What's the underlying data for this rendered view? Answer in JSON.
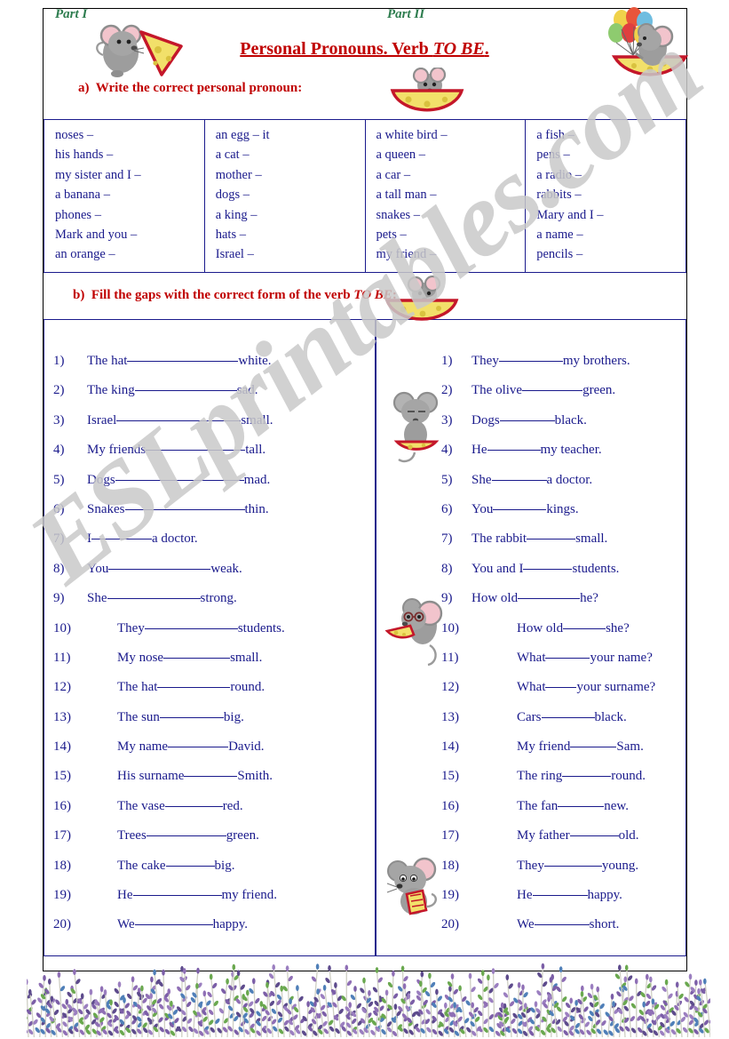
{
  "page": {
    "watermark": "ESLprintables.com",
    "title_main": "Personal Pronouns. Verb ",
    "title_italic": "TO BE",
    "title_end": "."
  },
  "instructions": {
    "a_label": "a)",
    "a_text": "Write the correct personal pronoun:",
    "b_label": "b)",
    "b_text_before": "Fill the gaps with the correct form of the verb ",
    "b_text_italic": "TO BE",
    "b_text_after": ":"
  },
  "pronoun_table": {
    "columns": [
      [
        "noses –",
        "his hands –",
        "my sister and I –",
        "a banana –",
        "phones –",
        "Mark and you –",
        "an orange –"
      ],
      [
        "an egg – it",
        "a cat –",
        "mother –",
        "dogs –",
        "a king –",
        "hats –",
        "Israel –"
      ],
      [
        "a white bird –",
        "a queen –",
        "a car –",
        "a tall man –",
        "snakes –",
        "pets –",
        "my friend –"
      ],
      [
        "a fish –",
        "pens –",
        "a radio –",
        "rabbits –",
        "Mary and I –",
        "a name –",
        "pencils –"
      ]
    ]
  },
  "part1": {
    "title": "Part I",
    "items": [
      {
        "num": "1)",
        "before": "The hat",
        "gap": 125,
        "after": "white."
      },
      {
        "num": "2)",
        "before": "The king",
        "gap": 115,
        "after": "sad."
      },
      {
        "num": "3)",
        "before": "Israel",
        "gap": 140,
        "after": "small."
      },
      {
        "num": "4)",
        "before": "My friends",
        "gap": 112,
        "after": "tall."
      },
      {
        "num": "5)",
        "before": "Dogs",
        "gap": 145,
        "after": "mad."
      },
      {
        "num": "6)",
        "before": "Snakes",
        "gap": 135,
        "after": "thin."
      },
      {
        "num": "7)",
        "before": "I",
        "gap": 68,
        "after": "a doctor."
      },
      {
        "num": "8)",
        "before": "You",
        "gap": 115,
        "after": "weak."
      },
      {
        "num": "9)",
        "before": "She",
        "gap": 105,
        "after": "strong."
      },
      {
        "num": "10)",
        "before": "They",
        "gap": 105,
        "after": "students."
      },
      {
        "num": "11)",
        "before": "My nose",
        "gap": 75,
        "after": "small."
      },
      {
        "num": "12)",
        "before": "The hat",
        "gap": 82,
        "after": "round."
      },
      {
        "num": "13)",
        "before": "The sun",
        "gap": 72,
        "after": "big."
      },
      {
        "num": "14)",
        "before": "My name",
        "gap": 68,
        "after": "David."
      },
      {
        "num": "15)",
        "before": "His surname",
        "gap": 60,
        "after": "Smith."
      },
      {
        "num": "16)",
        "before": "The vase",
        "gap": 65,
        "after": "red."
      },
      {
        "num": "17)",
        "before": "Trees",
        "gap": 90,
        "after": "green."
      },
      {
        "num": "18)",
        "before": "The cake",
        "gap": 55,
        "after": "big."
      },
      {
        "num": "19)",
        "before": "He",
        "gap": 100,
        "after": "my friend."
      },
      {
        "num": "20)",
        "before": "We",
        "gap": 88,
        "after": "happy."
      }
    ]
  },
  "part2": {
    "title": "Part II",
    "items": [
      {
        "num": "1)",
        "before": "They",
        "gap": 72,
        "after": "my brothers."
      },
      {
        "num": "2)",
        "before": "The olive",
        "gap": 68,
        "after": "green."
      },
      {
        "num": "3)",
        "before": "Dogs",
        "gap": 62,
        "after": "black."
      },
      {
        "num": "4)",
        "before": "He",
        "gap": 60,
        "after": "my teacher."
      },
      {
        "num": "5)",
        "before": "She",
        "gap": 62,
        "after": "a doctor."
      },
      {
        "num": "6)",
        "before": "You",
        "gap": 60,
        "after": "kings."
      },
      {
        "num": "7)",
        "before": "The rabbit",
        "gap": 55,
        "after": "small."
      },
      {
        "num": "8)",
        "before": "You and I",
        "gap": 55,
        "after": "students."
      },
      {
        "num": "9)",
        "before": "How old",
        "gap": 70,
        "after": "he?"
      },
      {
        "num": "10)",
        "before": "How old",
        "gap": 48,
        "after": "she?"
      },
      {
        "num": "11)",
        "before": "What",
        "gap": 50,
        "after": "your name?"
      },
      {
        "num": "12)",
        "before": "What",
        "gap": 35,
        "after": "your surname?"
      },
      {
        "num": "13)",
        "before": "Cars",
        "gap": 60,
        "after": "black."
      },
      {
        "num": "14)",
        "before": "My friend",
        "gap": 52,
        "after": "Sam."
      },
      {
        "num": "15)",
        "before": "The ring",
        "gap": 55,
        "after": "round."
      },
      {
        "num": "16)",
        "before": "The fan",
        "gap": 52,
        "after": "new."
      },
      {
        "num": "17)",
        "before": "My father",
        "gap": 55,
        "after": "old."
      },
      {
        "num": "18)",
        "before": "They",
        "gap": 65,
        "after": "young."
      },
      {
        "num": "19)",
        "before": "He",
        "gap": 62,
        "after": "happy."
      },
      {
        "num": "20)",
        "before": "We",
        "gap": 62,
        "after": "short."
      }
    ]
  },
  "colors": {
    "heading_red": "#c00000",
    "body_navy": "#1a1a8c",
    "part_green": "#2e7d4f",
    "watermark_grey": "#c9c9c9"
  },
  "clipart": {
    "mouse_cheese_topleft": "mouse-with-cheese-icon",
    "mouse_balloons_topright": "mouse-with-balloons-icon",
    "mouse_cheese_instruction": "mouse-in-cheese-icon",
    "mouse_boat": "mouse-on-cheese-boat-icon",
    "mouse_standing": "mouse-standing-icon",
    "mouse_glasses": "mouse-with-glasses-icon",
    "mouse_sitting": "mouse-sitting-icon",
    "grass_border": "lavender-grass-border-icon"
  }
}
